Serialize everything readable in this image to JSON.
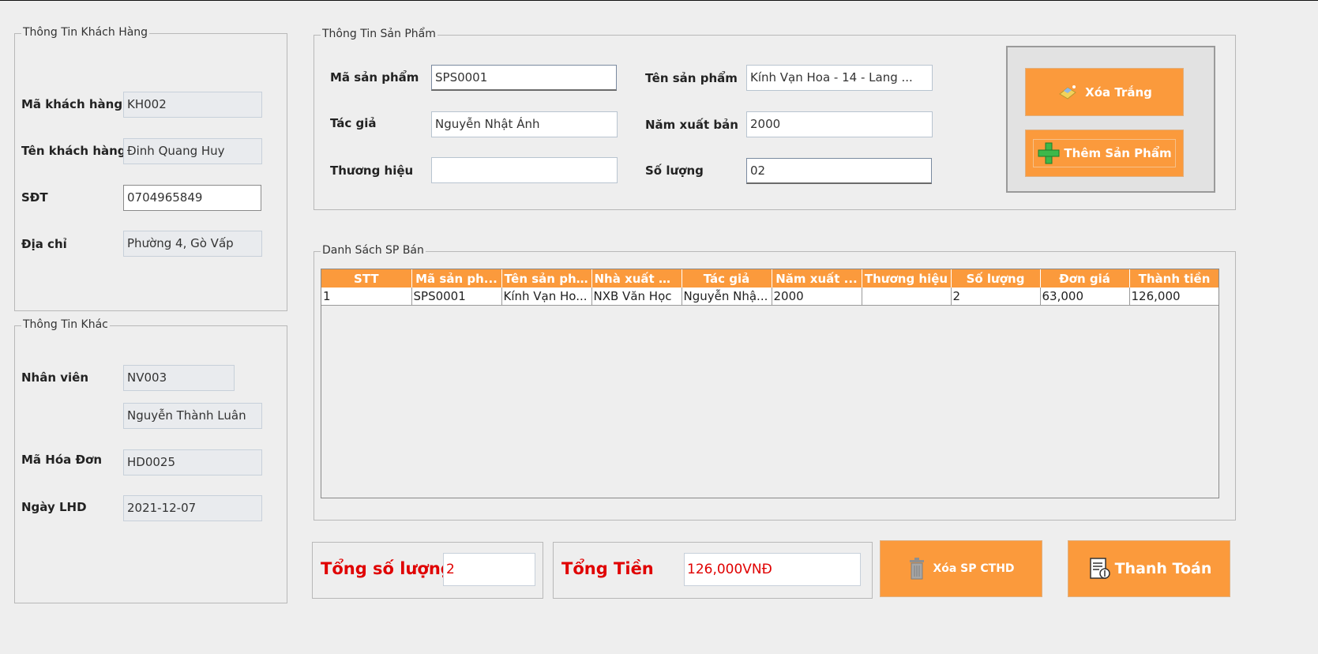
{
  "customer": {
    "legend": "Thông Tin Khách Hàng",
    "code_label": "Mã khách hàng",
    "code_value": "KH002",
    "name_label": "Tên khách hàng",
    "name_value": "Đinh Quang Huy",
    "phone_label": "SĐT",
    "phone_value": "0704965849",
    "address_label": "Địa chỉ",
    "address_value": "Phường 4, Gò Vấp"
  },
  "other": {
    "legend": "Thông Tin Khác",
    "staff_label": "Nhân viên",
    "staff_code": "NV003",
    "staff_name": "Nguyễn Thành Luân",
    "invoice_label": "Mã Hóa Đơn",
    "invoice_value": "HD0025",
    "date_label": "Ngày LHD",
    "date_value": "2021-12-07"
  },
  "product": {
    "legend": "Thông Tin Sản Phẩm",
    "code_label": "Mã sản phẩm",
    "code_value": "SPS0001",
    "name_label": "Tên sản phẩm",
    "name_value": "Kính Vạn Hoa - 14 - Lang ...",
    "author_label": "Tác giả",
    "author_value": "Nguyễn Nhật Ánh",
    "year_label": "Năm xuất bản",
    "year_value": "2000",
    "brand_label": "Thương hiệu",
    "brand_value": "",
    "qty_label": "Số lượng",
    "qty_value": "02"
  },
  "actions": {
    "clear_label": "Xóa Trắng",
    "add_label": "Thêm Sản Phẩm",
    "delete_label": "Xóa SP CTHD",
    "pay_label": "Thanh Toán"
  },
  "list": {
    "legend": "Danh Sách SP Bán",
    "columns": [
      "STT",
      "Mã sản ph...",
      "Tên sản ph...",
      "Nhà xuất b...",
      "Tác giả",
      "Năm xuất ...",
      "Thương hiệu",
      "Số lượng",
      "Đơn giá",
      "Thành tiền"
    ],
    "rows": [
      [
        "1",
        "SPS0001",
        "Kính Vạn Ho...",
        "NXB Văn Học",
        "Nguyễn Nhậ...",
        "2000",
        "",
        "2",
        "63,000",
        "126,000"
      ]
    ]
  },
  "totals": {
    "qty_label": "Tổng số lượng",
    "qty_value": "2",
    "money_label": "Tổng Tiền",
    "money_value": "126,000VNĐ"
  },
  "colors": {
    "accent": "#fb9a3c",
    "total_text": "#e00000",
    "background": "#eeeeee"
  }
}
